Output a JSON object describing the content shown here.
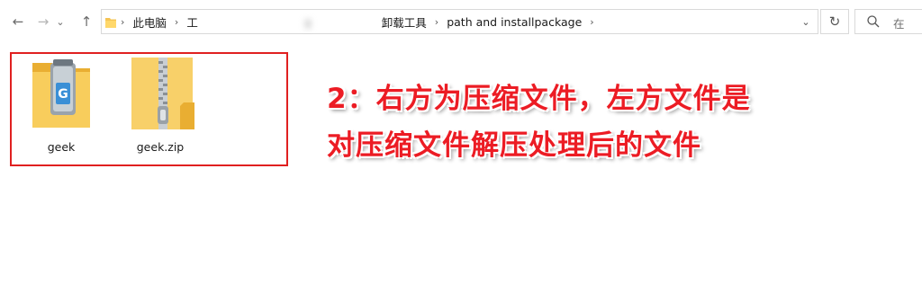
{
  "nav": {
    "back_icon": "←",
    "forward_icon": "→",
    "recent_icon": "⌄",
    "up_icon": "↑"
  },
  "address": {
    "crumbs": [
      "此电脑",
      "工",
      "g",
      "卸载工具",
      "path and installpackage"
    ],
    "separator": "›",
    "dropdown_icon": "⌄"
  },
  "refresh_icon": "↻",
  "search": {
    "placeholder": "在"
  },
  "files": [
    {
      "name": "geek",
      "icon": "app-folder-icon"
    },
    {
      "name": "geek.zip",
      "icon": "zip-folder-icon"
    }
  ],
  "annotation": {
    "line1": "2：右方为压缩文件，左方文件是",
    "line2": "对压缩文件解压处理后的文件"
  },
  "colors": {
    "annotation": "#ec1c24",
    "selection": "#e02020",
    "folder": "#f5c454"
  }
}
